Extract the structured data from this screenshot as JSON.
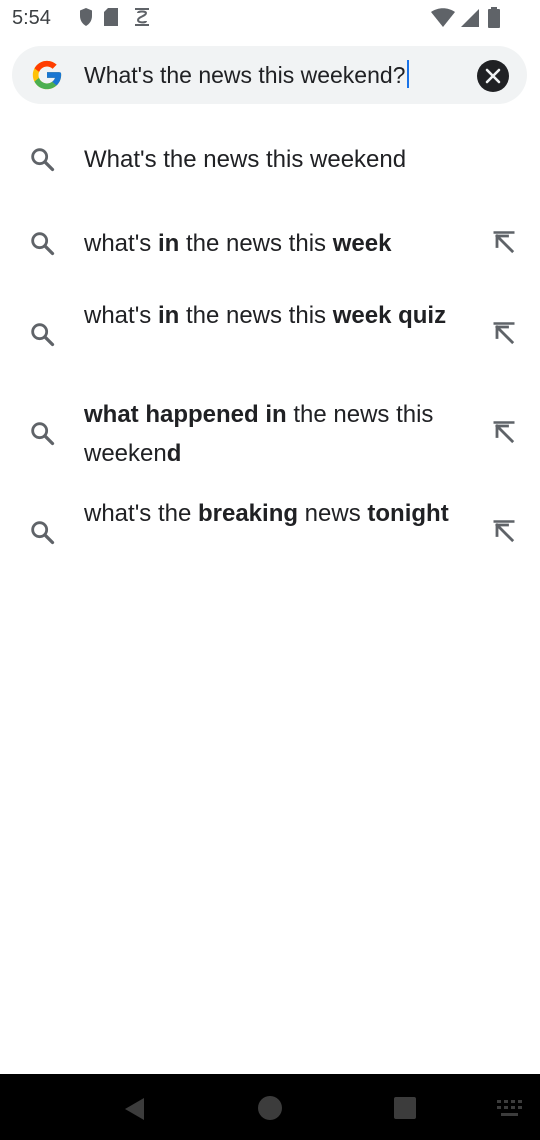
{
  "status_bar": {
    "time": "5:54"
  },
  "search": {
    "query": "What's the news this weekend?"
  },
  "suggestions": [
    {
      "parts": [
        {
          "t": "What's the news this weekend",
          "b": false
        }
      ],
      "has_arrow": false
    },
    {
      "parts": [
        {
          "t": "what's ",
          "b": false
        },
        {
          "t": "in",
          "b": true
        },
        {
          "t": " the news this ",
          "b": false
        },
        {
          "t": "week",
          "b": true
        }
      ],
      "has_arrow": true
    },
    {
      "parts": [
        {
          "t": "what's ",
          "b": false
        },
        {
          "t": "in",
          "b": true
        },
        {
          "t": " the news this ",
          "b": false
        },
        {
          "t": "week",
          "b": true
        },
        {
          "t": " quiz",
          "b": true
        }
      ],
      "has_arrow": true
    },
    {
      "parts": [
        {
          "t": "what happened in",
          "b": true
        },
        {
          "t": " the news this weeken",
          "b": false
        },
        {
          "t": "d",
          "b": true
        }
      ],
      "has_arrow": true
    },
    {
      "parts": [
        {
          "t": "what's the ",
          "b": false
        },
        {
          "t": "breaking",
          "b": true
        },
        {
          "t": " news ",
          "b": false
        },
        {
          "t": "tonight",
          "b": true
        }
      ],
      "has_arrow": true
    }
  ]
}
